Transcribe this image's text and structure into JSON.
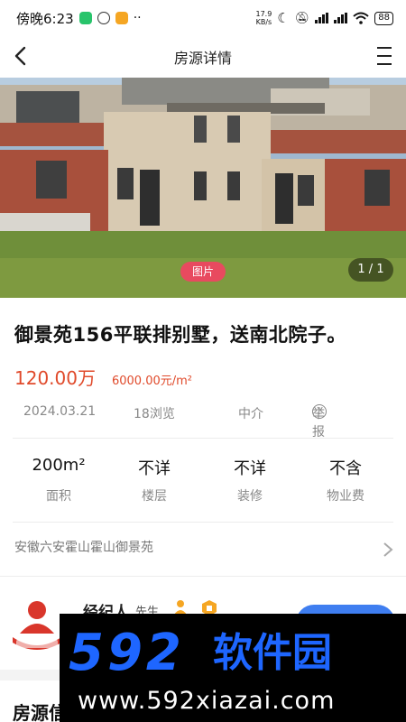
{
  "status_bar": {
    "time": "傍晚6:23",
    "net_speed_value": "17.9",
    "net_speed_unit": "KB/s",
    "battery": "88"
  },
  "nav": {
    "title": "房源详情"
  },
  "gallery": {
    "badge": "图片",
    "counter": "1 / 1"
  },
  "listing": {
    "title": "御景苑156平联排别墅，送南北院子。",
    "price_total": "120.00万",
    "price_unit": "6000.00元/m²",
    "date": "2024.03.21",
    "views": "18浏览",
    "source": "中介",
    "report": "举报"
  },
  "attributes": [
    {
      "value": "200m²",
      "label": "面积"
    },
    {
      "value": "不详",
      "label": "楼层"
    },
    {
      "value": "不详",
      "label": "装修"
    },
    {
      "value": "不含",
      "label": "物业费"
    }
  ],
  "address": "安徽六安霍山霍山御景苑",
  "agent": {
    "name": "经纪人",
    "title": "先生"
  },
  "section_title": "房源信",
  "watermark": {
    "logo": "592",
    "name": "软件园",
    "url": "www.592xiazai.com"
  },
  "colors": {
    "price": "#e04a2b",
    "badge": "#e84a5f",
    "button": "#3f7ef0",
    "watermark_blue": "#1e66ff"
  }
}
